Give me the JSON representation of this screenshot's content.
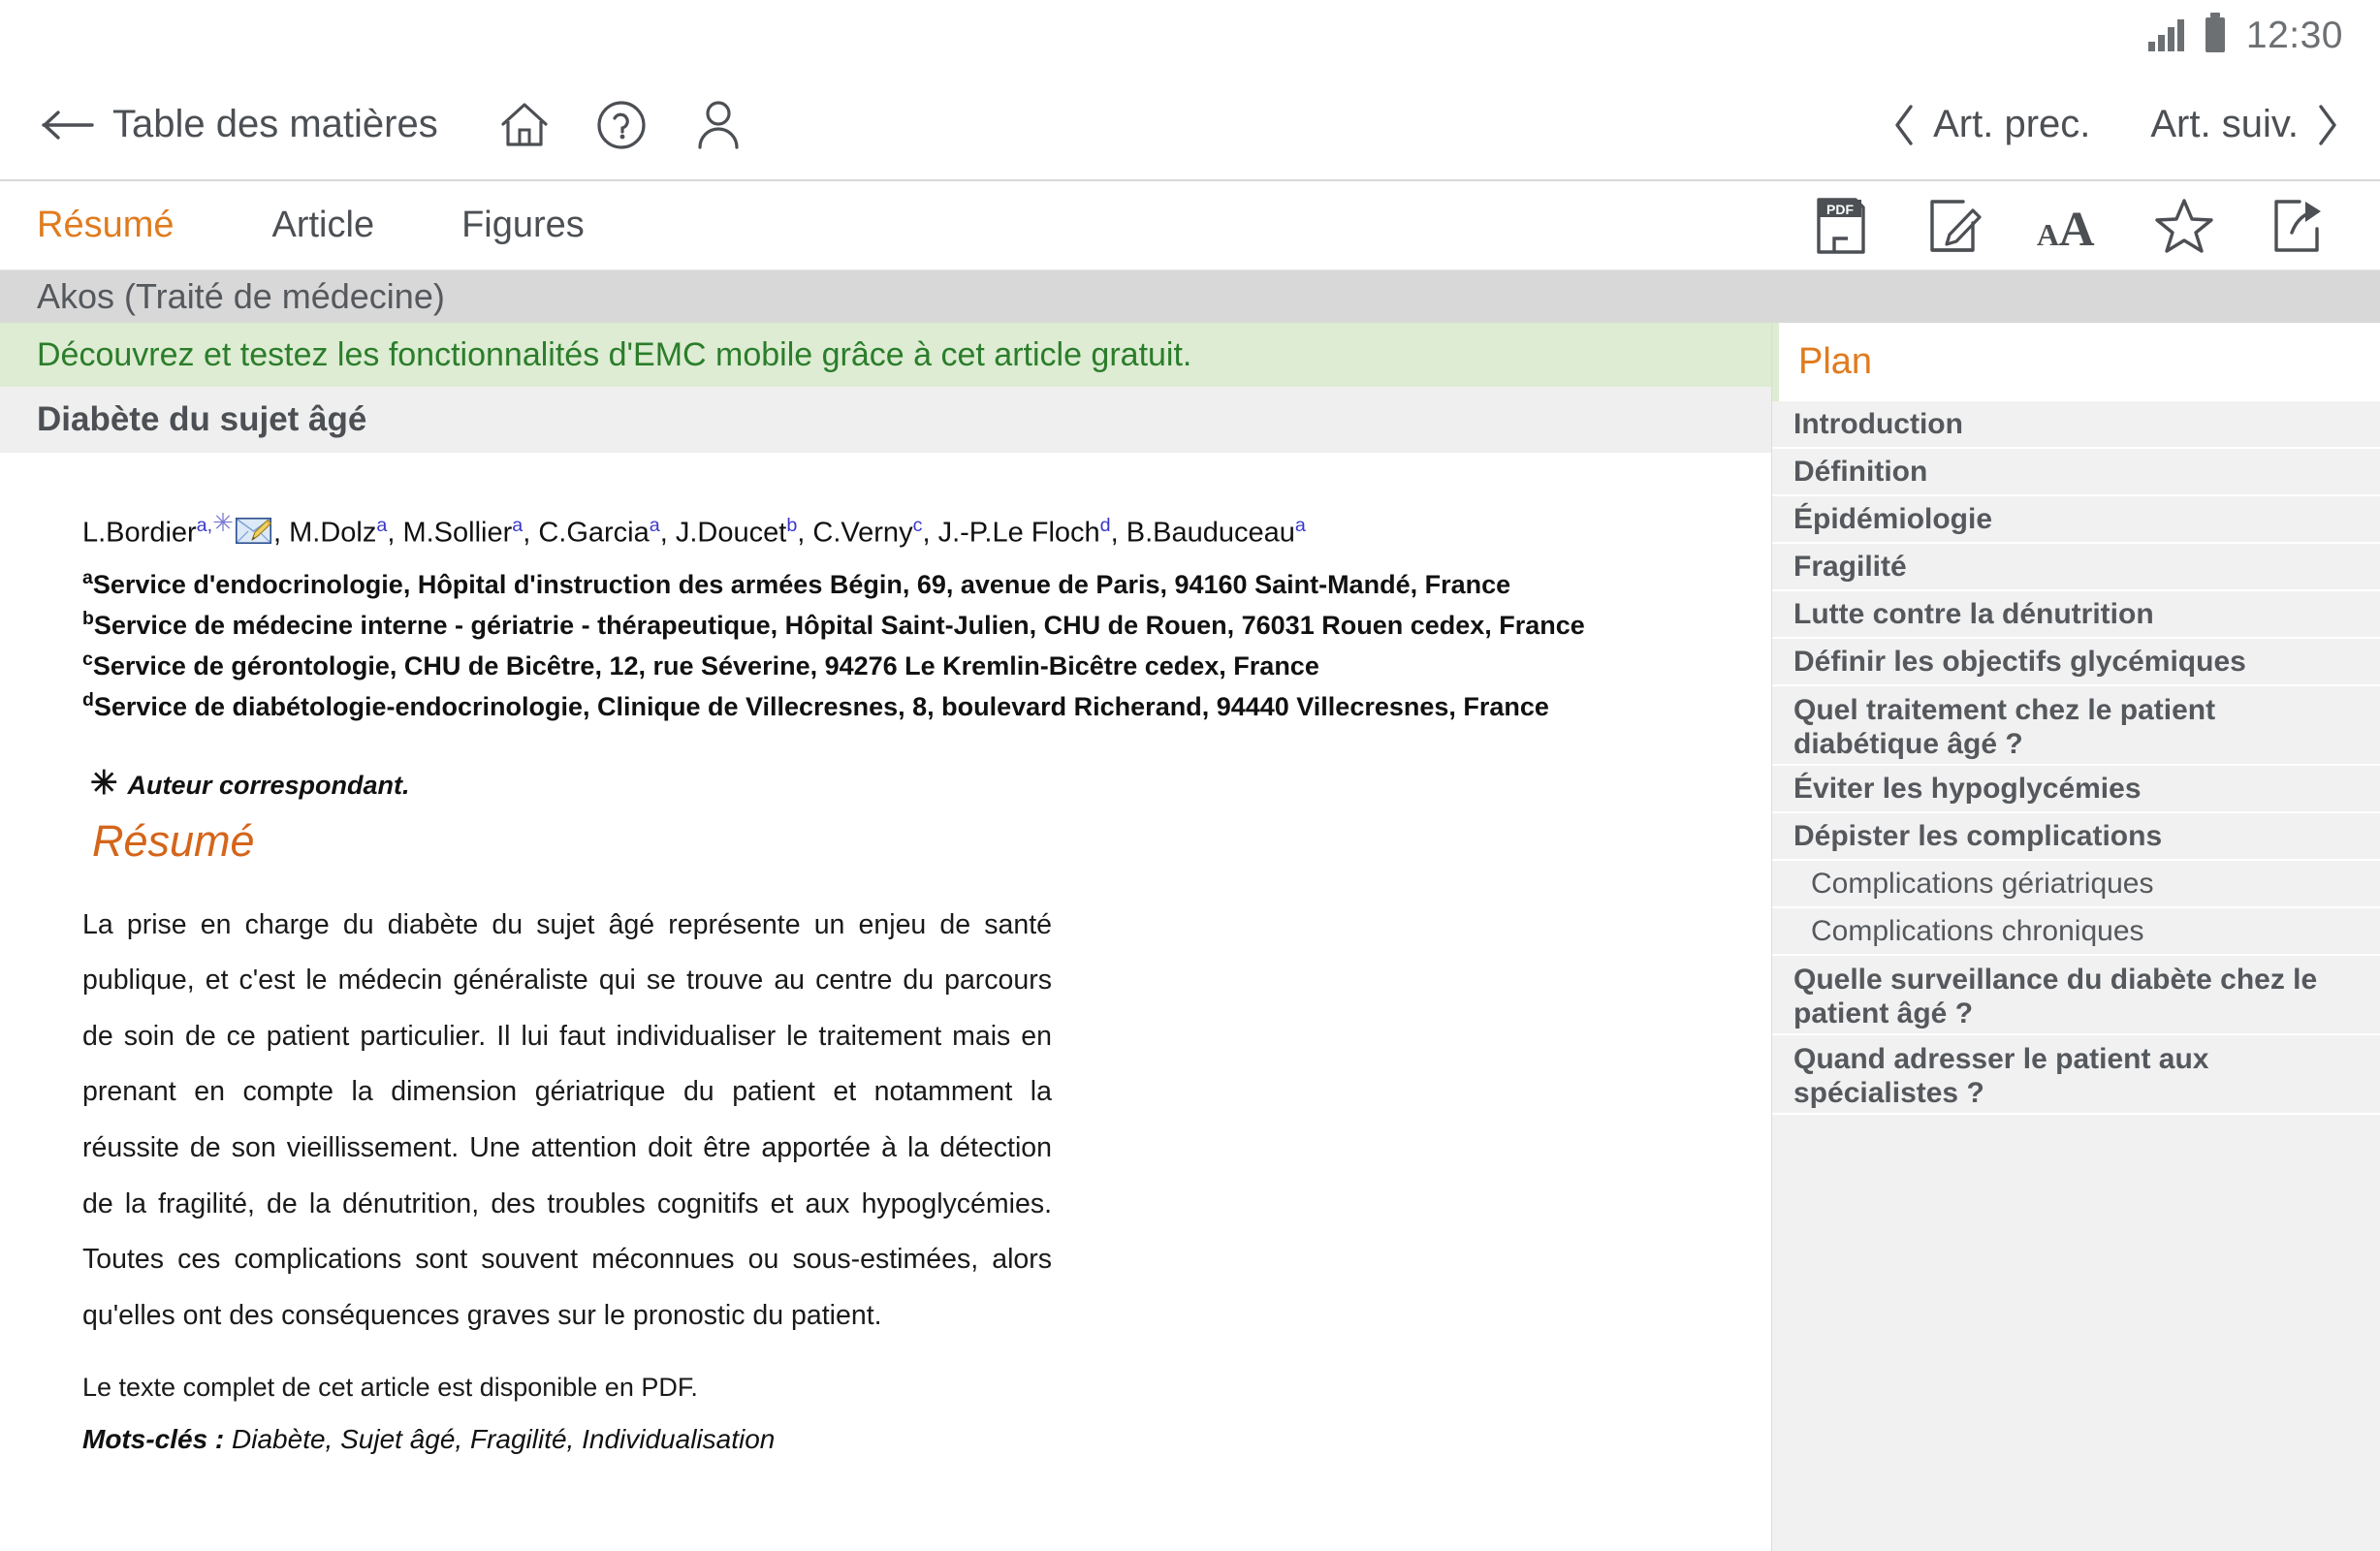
{
  "status_bar": {
    "signal_icon": "signal-bars-icon",
    "battery_icon": "battery-full-icon",
    "time": "12:30"
  },
  "topbar": {
    "back_icon": "back-arrow-icon",
    "toc_label": "Table des matières",
    "home_icon": "home-icon",
    "help_icon": "help-circle-icon",
    "account_icon": "user-account-icon",
    "prev_article_label": "Art. prec.",
    "prev_icon": "chevron-left-icon",
    "next_article_label": "Art. suiv.",
    "next_icon": "chevron-right-icon"
  },
  "tabs": [
    {
      "label": "Résumé",
      "active": true
    },
    {
      "label": "Article",
      "active": false
    },
    {
      "label": "Figures",
      "active": false
    }
  ],
  "tools": [
    {
      "name": "pdf-icon",
      "label": "PDF"
    },
    {
      "name": "annotate-note-icon",
      "label": ""
    },
    {
      "name": "font-size-icon",
      "label": "AA"
    },
    {
      "name": "favorite-star-icon",
      "label": ""
    },
    {
      "name": "share-export-icon",
      "label": ""
    }
  ],
  "article": {
    "journal": "Akos (Traité de médecine)",
    "free_banner": "Découvrez et testez les fonctionnalités d'EMC mobile grâce à cet article gratuit.",
    "title": "Diabète du sujet âgé",
    "authors": [
      {
        "name": "L.Bordier",
        "sup": "a,",
        "star": true,
        "mail_icon": "envelope-pencil-icon"
      },
      {
        "name": "M.Dolz",
        "sup": "a"
      },
      {
        "name": "M.Sollier",
        "sup": "a"
      },
      {
        "name": "C.Garcia",
        "sup": "a"
      },
      {
        "name": "J.Doucet",
        "sup": "b"
      },
      {
        "name": "C.Verny",
        "sup": "c"
      },
      {
        "name": "J.-P.Le Floch",
        "sup": "d"
      },
      {
        "name": "B.Bauduceau",
        "sup": "a"
      }
    ],
    "affiliations": [
      {
        "key": "a",
        "text": "Service d'endocrinologie, Hôpital d'instruction des armées Bégin, 69, avenue de Paris, 94160 Saint-Mandé, France"
      },
      {
        "key": "b",
        "text": "Service de médecine interne - gériatrie - thérapeutique, Hôpital Saint-Julien, CHU de Rouen, 76031 Rouen cedex, France"
      },
      {
        "key": "c",
        "text": "Service de gérontologie, CHU de Bicêtre, 12, rue Séverine, 94276 Le Kremlin-Bicêtre cedex, France"
      },
      {
        "key": "d",
        "text": "Service de diabétologie-endocrinologie, Clinique de Villecresnes, 8, boulevard Richerand, 94440 Villecresnes, France"
      }
    ],
    "corresponding_author": "Auteur correspondant.",
    "corresponding_symbol": "✳",
    "resume_heading": "Résumé",
    "abstract": "La prise en charge du diabète du sujet âgé représente un enjeu de santé publique, et c'est le médecin généraliste qui se trouve au centre du parcours de soin de ce patient particulier. Il lui faut individualiser le traitement mais en prenant en compte la dimension gériatrique du patient et notamment la réussite de son vieillissement. Une attention doit être apportée à la détection de la fragilité, de la dénutrition, des troubles cognitifs et aux hypoglycémies. Toutes ces complications sont souvent méconnues ou sous-estimées, alors qu'elles ont des conséquences graves sur le pronostic du patient.",
    "pdf_note": "Le texte complet de cet article est disponible en PDF.",
    "keywords_label": "Mots-clés :",
    "keywords_value": "Diabète, Sujet âgé, Fragilité, Individualisation"
  },
  "plan": {
    "title": "Plan",
    "items": [
      {
        "label": "Introduction",
        "level": 1,
        "lines": 1
      },
      {
        "label": "Définition",
        "level": 1,
        "lines": 1
      },
      {
        "label": "Épidémiologie",
        "level": 1,
        "lines": 1
      },
      {
        "label": "Fragilité",
        "level": 1,
        "lines": 1
      },
      {
        "label": "Lutte contre la dénutrition",
        "level": 1,
        "lines": 1
      },
      {
        "label": "Définir les objectifs glycémiques",
        "level": 1,
        "lines": 1
      },
      {
        "label": "Quel traitement chez le patient diabétique âgé ?",
        "level": 1,
        "lines": 2
      },
      {
        "label": "Éviter les hypoglycémies",
        "level": 1,
        "lines": 1
      },
      {
        "label": "Dépister les complications",
        "level": 1,
        "lines": 1
      },
      {
        "label": "Complications gériatriques",
        "level": 2,
        "lines": 1
      },
      {
        "label": "Complications chroniques",
        "level": 2,
        "lines": 1
      },
      {
        "label": "Quelle surveillance du diabète chez le patient âgé ?",
        "level": 1,
        "lines": 2
      },
      {
        "label": "Quand adresser le patient aux spécialistes ?",
        "level": 1,
        "lines": 2
      }
    ]
  },
  "colors": {
    "accent_orange": "#e07b1e",
    "free_banner_bg": "#ddecd2",
    "free_banner_text": "#2b7d2b",
    "journal_band_bg": "#d8d8d8",
    "sidebar_bg": "#f1f1f1",
    "text_gray": "#55585c"
  }
}
